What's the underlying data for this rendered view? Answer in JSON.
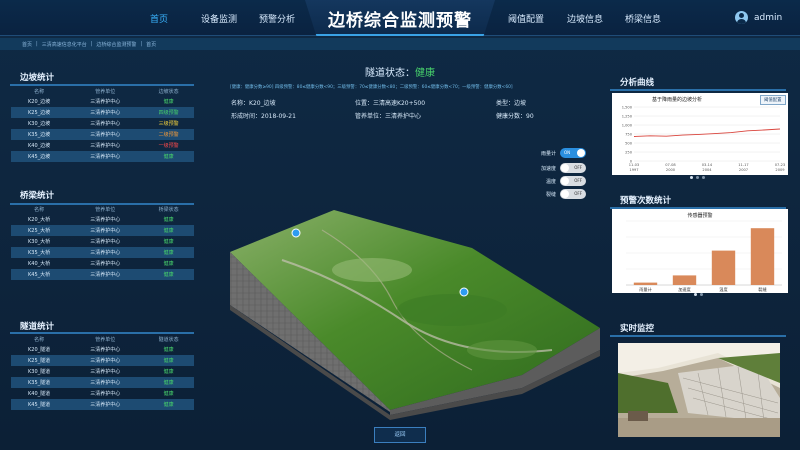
{
  "header": {
    "title": "边桥综合监测预警",
    "nav_left": [
      "首页",
      "设备监测",
      "预警分析"
    ],
    "nav_right": [
      "阈值配置",
      "边坡信息",
      "桥梁信息"
    ],
    "user": "admin",
    "active_nav": "首页"
  },
  "breadcrumb": [
    "首页",
    "三清高速信息化平台",
    "边桥综合监测预警",
    "首页"
  ],
  "left": {
    "slope": {
      "title": "边坡统计",
      "headers": [
        "名称",
        "管养单位",
        "边坡状态"
      ],
      "rows": [
        {
          "name": "K20_边坡",
          "unit": "三清养护中心",
          "status": "健康",
          "color": "#47d16b"
        },
        {
          "name": "K25_边坡",
          "unit": "三清养护中心",
          "status": "四级预警",
          "color": "#47d16b"
        },
        {
          "name": "K30_边坡",
          "unit": "三清养护中心",
          "status": "三级预警",
          "color": "#f4d23c"
        },
        {
          "name": "K35_边坡",
          "unit": "三清养护中心",
          "status": "二级预警",
          "color": "#f39a3a"
        },
        {
          "name": "K40_边坡",
          "unit": "三清养护中心",
          "status": "一级预警",
          "color": "#ff4a4a"
        },
        {
          "name": "K45_边坡",
          "unit": "三清养护中心",
          "status": "健康",
          "color": "#47d16b"
        }
      ]
    },
    "bridge": {
      "title": "桥梁统计",
      "headers": [
        "名称",
        "管养单位",
        "桥梁状态"
      ],
      "rows": [
        {
          "name": "K20_大桥",
          "unit": "三清养护中心",
          "status": "健康"
        },
        {
          "name": "K25_大桥",
          "unit": "三清养护中心",
          "status": "健康"
        },
        {
          "name": "K30_大桥",
          "unit": "三清养护中心",
          "status": "健康"
        },
        {
          "name": "K35_大桥",
          "unit": "三清养护中心",
          "status": "健康"
        },
        {
          "name": "K40_大桥",
          "unit": "三清养护中心",
          "status": "健康"
        },
        {
          "name": "K45_大桥",
          "unit": "三清养护中心",
          "status": "健康"
        }
      ]
    },
    "tunnel": {
      "title": "隧道统计",
      "headers": [
        "名称",
        "管养单位",
        "隧道状态"
      ],
      "rows": [
        {
          "name": "K20_隧道",
          "unit": "三清养护中心",
          "status": "健康"
        },
        {
          "name": "K25_隧道",
          "unit": "三清养护中心",
          "status": "健康"
        },
        {
          "name": "K30_隧道",
          "unit": "三清养护中心",
          "status": "健康"
        },
        {
          "name": "K35_隧道",
          "unit": "三清养护中心",
          "status": "健康"
        },
        {
          "name": "K40_隧道",
          "unit": "三清养护中心",
          "status": "健康"
        },
        {
          "name": "K45_隧道",
          "unit": "三清养护中心",
          "status": "健康"
        }
      ]
    }
  },
  "center": {
    "status_label": "隧道状态：",
    "status_value": "健康",
    "legend_text": "[健康：健康分数≥90] 四级预警：80≤健康分数<90；三级预警：70≤健康分数<80；二级预警：60≤健康分数<70；一级预警：健康分数<60]",
    "info": {
      "name_label": "名称：",
      "name": "K20_边坡",
      "pos_label": "位置：",
      "pos": "三清高速K20+500",
      "type_label": "类型：",
      "type": "边坡",
      "time_label": "形成时间：",
      "time": "2018-09-21",
      "unit_label": "管养单位：",
      "unit": "三清养护中心",
      "score_label": "健康分数：",
      "score": "90"
    },
    "toggles": [
      {
        "label": "雨量计",
        "state": "ON",
        "on": true
      },
      {
        "label": "加速度",
        "state": "OFF",
        "on": false
      },
      {
        "label": "温度",
        "state": "OFF",
        "on": false
      },
      {
        "label": "裂缝",
        "state": "OFF",
        "on": false
      }
    ],
    "back_label": "返回"
  },
  "right": {
    "analysis_title": "分析曲线",
    "chart1": {
      "title": "基于降雨量的边坡分析",
      "button": "阈值配置",
      "y_ticks": [
        "1,500",
        "1,250",
        "1,000",
        "750",
        "500",
        "250",
        "0"
      ],
      "x_ticks": [
        "11-03",
        "07-08",
        "03-14",
        "11-17",
        "07-23"
      ],
      "x_years": [
        "1997",
        "2000",
        "2004",
        "2007",
        "2009"
      ]
    },
    "warning_title": "预警次数统计",
    "chart2_title": "传感器预警",
    "monitor_title": "实时监控"
  },
  "chart_data": [
    {
      "type": "line",
      "title": "基于降雨量的边坡分析",
      "ylim": [
        0,
        1500
      ],
      "x": [
        "1997-11-03",
        "2000-07-08",
        "2004-03-14",
        "2007-11-17",
        "2009-07-23"
      ],
      "series": [
        {
          "values": [
            680,
            700,
            690,
            720,
            740,
            760,
            790,
            840,
            860,
            890
          ]
        }
      ],
      "color": "#d9443c"
    },
    {
      "type": "bar",
      "title": "传感器预警",
      "categories": [
        "雨量计",
        "加速度",
        "温度",
        "裂缝"
      ],
      "values": [
        3,
        12,
        43,
        71
      ],
      "ylim": [
        0,
        80
      ],
      "color": "#d9895a"
    }
  ]
}
